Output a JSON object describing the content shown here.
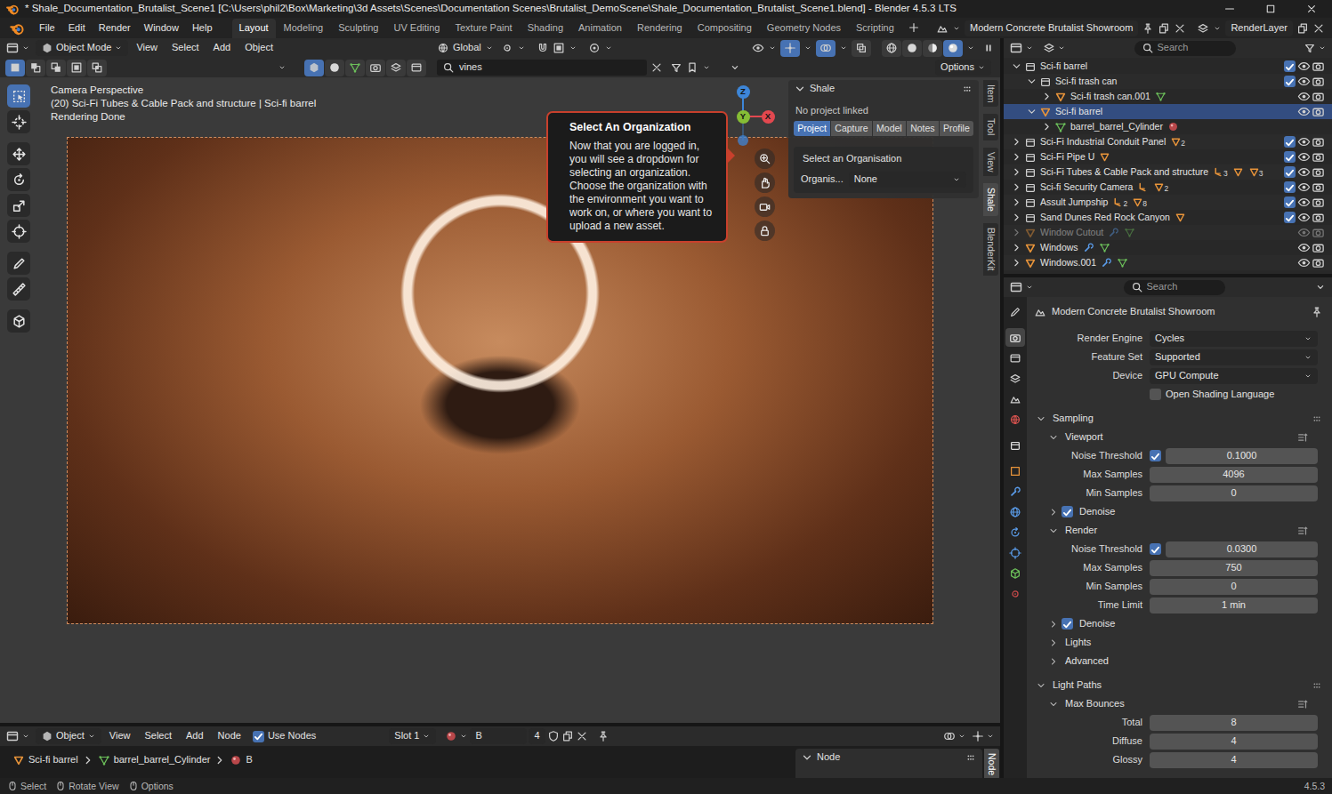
{
  "window": {
    "title": "* Shale_Documentation_Brutalist_Scene1 [C:\\Users\\phil2\\Box\\Marketing\\3d Assets\\Scenes\\Documentation Scenes\\Brutalist_DemoScene\\Shale_Documentation_Brutalist_Scene1.blend] - Blender 4.5.3 LTS"
  },
  "menu": [
    "File",
    "Edit",
    "Render",
    "Window",
    "Help"
  ],
  "workspaces": [
    {
      "label": "Layout",
      "selected": true
    },
    {
      "label": "Modeling",
      "selected": false
    },
    {
      "label": "Sculpting",
      "selected": false
    },
    {
      "label": "UV Editing",
      "selected": false
    },
    {
      "label": "Texture Paint",
      "selected": false
    },
    {
      "label": "Shading",
      "selected": false
    },
    {
      "label": "Animation",
      "selected": false
    },
    {
      "label": "Rendering",
      "selected": false
    },
    {
      "label": "Compositing",
      "selected": false
    },
    {
      "label": "Geometry Nodes",
      "selected": false
    },
    {
      "label": "Scripting",
      "selected": false
    }
  ],
  "scene": "Modern Concrete Brutalist Showroom",
  "view_layer": "RenderLayer",
  "viewport": {
    "mode": "Object Mode",
    "menus": [
      "View",
      "Select",
      "Add",
      "Object"
    ],
    "orientation": "Global",
    "toggles": [
      {
        "on": true
      },
      {
        "on": true
      },
      {
        "on": false
      }
    ],
    "shading": [
      {
        "selected": false
      },
      {
        "selected": false
      },
      {
        "selected": false
      },
      {
        "selected": true
      }
    ],
    "select_modes": [
      {
        "selected": true
      },
      {
        "selected": false
      },
      {
        "selected": false
      },
      {
        "selected": false
      },
      {
        "selected": false
      }
    ],
    "filters": [
      {
        "selected": true
      },
      {
        "selected": false
      },
      {
        "selected": false
      },
      {
        "selected": false
      },
      {
        "selected": false
      },
      {
        "selected": false
      }
    ],
    "search": "vines",
    "options": "Options",
    "overlay": [
      "Camera Perspective",
      "(20) Sci-Fi Tubes & Cable Pack and structure | Sci-fi barrel",
      "Rendering Done"
    ],
    "tools": [
      {
        "selected": true
      },
      {
        "selected": false
      },
      {
        "selected": false
      },
      {
        "selected": false
      },
      {
        "selected": false
      },
      {
        "selected": false
      },
      {
        "selected": false
      },
      {
        "selected": false
      },
      {
        "selected": false
      }
    ],
    "axes": [
      {
        "label": "Z",
        "color": "#3d86d8"
      },
      {
        "label": "Y",
        "color": "#86bd35"
      },
      {
        "label": "X",
        "color": "#e2484f"
      }
    ]
  },
  "tooltip": {
    "title": "Select An Organization",
    "body": "Now that you are logged in, you will see a dropdown for selecting an organization. Choose the organization with the environment you want to work on, or where you want to upload a new asset."
  },
  "shale": {
    "title": "Shale",
    "status": "No project linked",
    "tabs": [
      {
        "label": "Project",
        "selected": true
      },
      {
        "label": "Capture",
        "selected": false
      },
      {
        "label": "Model",
        "selected": false
      },
      {
        "label": "Notes",
        "selected": false
      },
      {
        "label": "Profile",
        "selected": false
      }
    ],
    "section": "Select an Organisation",
    "field_label": "Organis...",
    "field_value": "None"
  },
  "sidebar_tabs": [
    {
      "label": "Item",
      "selected": false
    },
    {
      "label": "Tool",
      "selected": false
    },
    {
      "label": "View",
      "selected": false
    },
    {
      "label": "Shale",
      "selected": true
    },
    {
      "label": "BlenderKit",
      "selected": false
    }
  ],
  "outliner": {
    "search": "Search",
    "rows": [
      {
        "label": "Sci-fi barrel",
        "depth": 0,
        "kind": "collection",
        "expanded": true,
        "checked": true,
        "selected": false,
        "disabled": false,
        "children": []
      },
      {
        "label": "Sci-fi trash can",
        "depth": 1,
        "kind": "collection",
        "expanded": true,
        "checked": true,
        "selected": false,
        "disabled": false,
        "children": []
      },
      {
        "label": "Sci-fi trash can.001",
        "depth": 2,
        "kind": "object",
        "expanded": false,
        "selected": false,
        "disabled": false,
        "children": [
          {
            "kind": "mesh"
          }
        ]
      },
      {
        "label": "Sci-fi barrel",
        "depth": 1,
        "kind": "object",
        "expanded": true,
        "selected": true,
        "disabled": false,
        "children": []
      },
      {
        "label": "barrel_barrel_Cylinder",
        "depth": 2,
        "kind": "mesh",
        "expanded": false,
        "selected": false,
        "disabled": false,
        "children": [
          {
            "kind": "material"
          }
        ]
      },
      {
        "label": "Sci-Fi Industrial Conduit Panel",
        "depth": 0,
        "kind": "collection",
        "expanded": false,
        "checked": true,
        "selected": false,
        "disabled": false,
        "children": [
          {
            "kind": "object",
            "count": "2"
          }
        ]
      },
      {
        "label": "Sci-Fi Pipe U",
        "depth": 0,
        "kind": "collection",
        "expanded": false,
        "checked": true,
        "selected": false,
        "disabled": false,
        "children": [
          {
            "kind": "object"
          }
        ]
      },
      {
        "label": "Sci-Fi Tubes & Cable Pack and structure",
        "depth": 0,
        "kind": "collection",
        "expanded": false,
        "checked": true,
        "selected": false,
        "disabled": false,
        "children": [
          {
            "kind": "armature",
            "count": "3"
          },
          {
            "kind": "object"
          },
          {
            "kind": "object",
            "count": "3"
          }
        ]
      },
      {
        "label": "Sci-fi Security Camera",
        "depth": 0,
        "kind": "collection",
        "expanded": false,
        "checked": true,
        "selected": false,
        "disabled": false,
        "children": [
          {
            "kind": "armature"
          },
          {
            "kind": "object",
            "count": "2"
          }
        ]
      },
      {
        "label": "Assult Jumpship",
        "depth": 0,
        "kind": "collection",
        "expanded": false,
        "checked": true,
        "selected": false,
        "disabled": false,
        "children": [
          {
            "kind": "armature",
            "count": "2"
          },
          {
            "kind": "object",
            "count": "8"
          }
        ]
      },
      {
        "label": "Sand Dunes Red Rock Canyon",
        "depth": 0,
        "kind": "collection",
        "expanded": false,
        "checked": true,
        "selected": false,
        "disabled": false,
        "children": [
          {
            "kind": "object"
          }
        ]
      },
      {
        "label": "Window Cutout",
        "depth": 0,
        "kind": "object",
        "expanded": false,
        "selected": false,
        "disabled": true,
        "children": [
          {
            "kind": "modifier"
          },
          {
            "kind": "mesh"
          }
        ]
      },
      {
        "label": "Windows",
        "depth": 0,
        "kind": "object",
        "expanded": false,
        "selected": false,
        "disabled": false,
        "children": [
          {
            "kind": "modifier"
          },
          {
            "kind": "mesh"
          }
        ]
      },
      {
        "label": "Windows.001",
        "depth": 0,
        "kind": "object",
        "expanded": false,
        "selected": false,
        "disabled": false,
        "children": [
          {
            "kind": "modifier"
          },
          {
            "kind": "mesh"
          }
        ]
      }
    ]
  },
  "properties": {
    "search": "Search",
    "title": "Modern Concrete Brutalist Showroom",
    "tabs": [
      {
        "selected": false,
        "color": "#c8c8c8"
      },
      {
        "selected": true,
        "color": "#e2e2e2"
      },
      {
        "selected": false,
        "color": "#d0d0d0"
      },
      {
        "selected": false,
        "color": "#d0d0d0"
      },
      {
        "selected": false,
        "color": "#d0d0d0"
      },
      {
        "selected": false,
        "color": "#d9534f"
      },
      {
        "selected": false,
        "color": "#e0e0e0"
      },
      {
        "selected": false,
        "color": "#e8943a"
      },
      {
        "selected": false,
        "color": "#5a9be8"
      },
      {
        "selected": false,
        "color": "#5a9be8"
      },
      {
        "selected": false,
        "color": "#5a9be8"
      },
      {
        "selected": false,
        "color": "#5a9be8"
      },
      {
        "selected": false,
        "color": "#6cbf5a"
      },
      {
        "selected": false,
        "color": "#c84a4a"
      }
    ],
    "rows": [
      {
        "kind": "dropdown",
        "label": "Render Engine",
        "value": "Cycles"
      },
      {
        "kind": "dropdown",
        "label": "Feature Set",
        "value": "Supported"
      },
      {
        "kind": "dropdown",
        "label": "Device",
        "value": "GPU Compute"
      },
      {
        "kind": "checkbox",
        "label": "Open Shading Language",
        "checked": false
      },
      {
        "kind": "panel",
        "label": "Sampling",
        "depth": 0,
        "expanded": true
      },
      {
        "kind": "panel",
        "label": "Viewport",
        "depth": 1,
        "expanded": true
      },
      {
        "kind": "toggle-number",
        "label": "Noise Threshold",
        "value": "0.1000",
        "checked": true
      },
      {
        "kind": "number",
        "label": "Max Samples",
        "value": "4096"
      },
      {
        "kind": "number",
        "label": "Min Samples",
        "value": "0"
      },
      {
        "kind": "toggle-panel",
        "label": "Denoise",
        "depth": 1,
        "expanded": false,
        "checked": true
      },
      {
        "kind": "panel",
        "label": "Render",
        "depth": 1,
        "expanded": true
      },
      {
        "kind": "toggle-number",
        "label": "Noise Threshold",
        "value": "0.0300",
        "checked": true
      },
      {
        "kind": "number",
        "label": "Max Samples",
        "value": "750"
      },
      {
        "kind": "number",
        "label": "Min Samples",
        "value": "0"
      },
      {
        "kind": "number",
        "label": "Time Limit",
        "value": "1 min"
      },
      {
        "kind": "toggle-panel",
        "label": "Denoise",
        "depth": 1,
        "expanded": false,
        "checked": true
      },
      {
        "kind": "panel",
        "label": "Lights",
        "depth": 1,
        "expanded": false
      },
      {
        "kind": "panel",
        "label": "Advanced",
        "depth": 1,
        "expanded": false
      },
      {
        "kind": "panel",
        "label": "Light Paths",
        "depth": 0,
        "expanded": true
      },
      {
        "kind": "panel",
        "label": "Max Bounces",
        "depth": 1,
        "expanded": true
      },
      {
        "kind": "number",
        "label": "Total",
        "value": "8"
      },
      {
        "kind": "number",
        "label": "Diffuse",
        "value": "4"
      },
      {
        "kind": "number",
        "label": "Glossy",
        "value": "4"
      }
    ]
  },
  "node_editor": {
    "mode": "Object",
    "menus": [
      "View",
      "Select",
      "Add",
      "Node"
    ],
    "use_nodes": {
      "label": "Use Nodes",
      "checked": true
    },
    "slot": "Slot 1",
    "material": "B",
    "users": "4",
    "breadcrumb": [
      "Sci-fi barrel",
      "barrel_barrel_Cylinder",
      "B"
    ],
    "panel": "Node",
    "sidebar_tab": "Node"
  },
  "status_bar": {
    "items": [
      "Select",
      "Rotate View",
      "Options"
    ],
    "version": "4.5.3"
  }
}
